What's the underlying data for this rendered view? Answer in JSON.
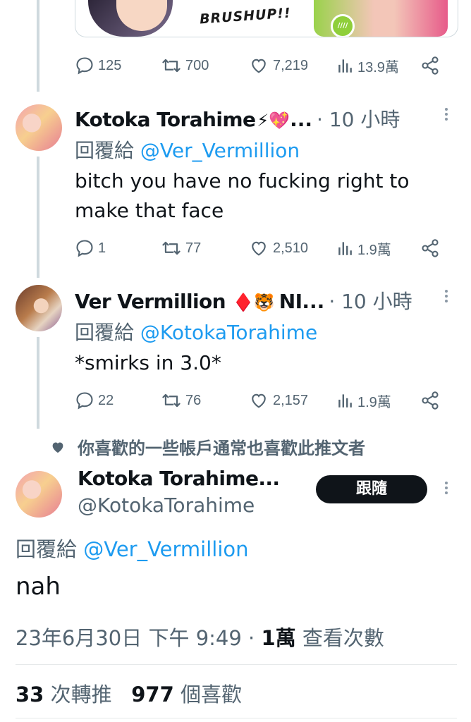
{
  "banner": {
    "text": "BRUSHUP!!",
    "right_badge": "////"
  },
  "top_actions": {
    "replies": "125",
    "retweets": "700",
    "likes": "7,219",
    "views": "13.9萬"
  },
  "tweets": [
    {
      "name": "Kotoka Torahime",
      "emojis": "⚡💖",
      "time": "· 10 小時",
      "reply_prefix": "回覆給",
      "reply_handle": "@Ver_Vermillion",
      "text": "bitch you have no fucking right to make that face",
      "actions": {
        "replies": "1",
        "retweets": "77",
        "likes": "2,510",
        "views": "1.9萬"
      }
    },
    {
      "name": "Ver Vermillion",
      "emojis": "♦️🐯",
      "name_tail": "NI",
      "time": "· 10 小時",
      "reply_prefix": "回覆給",
      "reply_handle": "@KotokaTorahime",
      "text": "*smirks in 3.0*",
      "actions": {
        "replies": "22",
        "retweets": "76",
        "likes": "2,157",
        "views": "1.9萬"
      }
    }
  ],
  "suggestion": {
    "text": "你喜歡的一些帳戶通常也喜歡此推文者"
  },
  "main_tweet": {
    "name": "Kotoka Torahime...",
    "handle": "@KotokaTorahime",
    "follow_label": "跟隨",
    "reply_prefix": "回覆給",
    "reply_handle": "@Ver_Vermillion",
    "text": "nah",
    "date": "23年6月30日 下午 9:49",
    "views_count": "1萬",
    "views_label": "查看次數",
    "retweets_count": "33",
    "retweets_label": "次轉推",
    "likes_count": "977",
    "likes_label": "個喜歡"
  },
  "colors": {
    "accent": "#1d9bf0",
    "muted": "#536471",
    "text": "#0f1419",
    "follow_bg": "#0f1419"
  }
}
